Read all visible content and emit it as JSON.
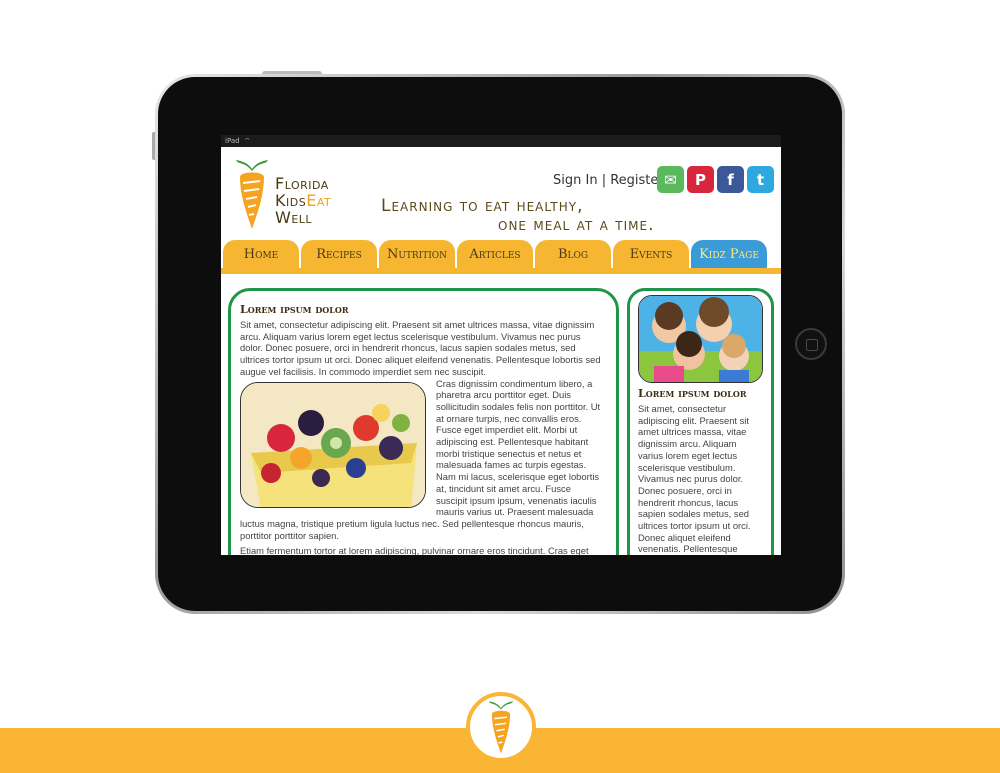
{
  "status_bar": {
    "device": "iPad"
  },
  "brand": {
    "logo_words": [
      "Florida",
      "Kids",
      "Eat",
      "Well"
    ],
    "tagline_line1": "Learning to eat healthy,",
    "tagline_line2": "one meal at a time."
  },
  "auth": {
    "sign_in": "Sign In",
    "separator": " | ",
    "register": "Register"
  },
  "social": [
    {
      "icon": "email-icon",
      "glyph": "✉",
      "color": "#5cb85c"
    },
    {
      "icon": "pinterest-icon",
      "glyph": "P",
      "color": "#d7263d"
    },
    {
      "icon": "facebook-icon",
      "glyph": "f",
      "color": "#3b5998"
    },
    {
      "icon": "twitter-icon",
      "glyph": "t",
      "color": "#2fa8e0"
    }
  ],
  "nav": {
    "items": [
      "Home",
      "Recipes",
      "Nutrition",
      "Articles",
      "Blog",
      "Events",
      "Kidz Page"
    ],
    "active_color": "#3a9bd6",
    "tab_color": "#f7b632"
  },
  "main": {
    "heading": "Lorem ipsum dolor",
    "para1": "Sit amet, consectetur adipiscing elit. Praesent sit amet ultrices massa, vitae dignissim arcu. Aliquam varius lorem eget lectus scelerisque vestibulum. Vivamus nec purus dolor. Donec posuere, orci in hendrerit rhoncus, lacus sapien sodales metus, sed ultrices tortor ipsum ut orci. Donec aliquet eleifend venenatis. Pellentesque lobortis sed augue vel facilisis. In commodo imperdiet sem nec suscipit.",
    "para2": "Cras dignissim condimentum libero, a pharetra arcu porttitor eget. Duis sollicitudin sodales felis non porttitor. Ut at ornare turpis, nec convallis eros. Fusce eget imperdiet elit. Morbi ut adipiscing est. Pellentesque habitant morbi tristique senectus et netus et malesuada fames ac turpis egestas. Nam mi lacus, scelerisque eget lobortis at, tincidunt sit amet arcu. Fusce suscipit ipsum ipsum, venenatis iaculis mauris varius ut. Praesent malesuada luctus magna, tristique pretium ligula luctus nec. Sed pellentesque rhoncus mauris, porttitor porttitor sapien.",
    "para3": "Etiam fermentum tortor at lorem adipiscing, pulvinar ornare eros tincidunt. Cras eget"
  },
  "sidebar": {
    "heading": "Lorem ipsum dolor",
    "para": "Sit amet, consectetur adipiscing elit. Praesent sit amet ultrices massa, vitae dignissim arcu. Aliquam varius lorem eget lectus scelerisque vestibulum. Vivamus nec purus dolor. Donec posuere, orci in hendrerit rhoncus, lacus sapien sodales metus, sed ultrices tortor ipsum ut orci. Donec aliquet eleifend venenatis. Pellentesque"
  }
}
